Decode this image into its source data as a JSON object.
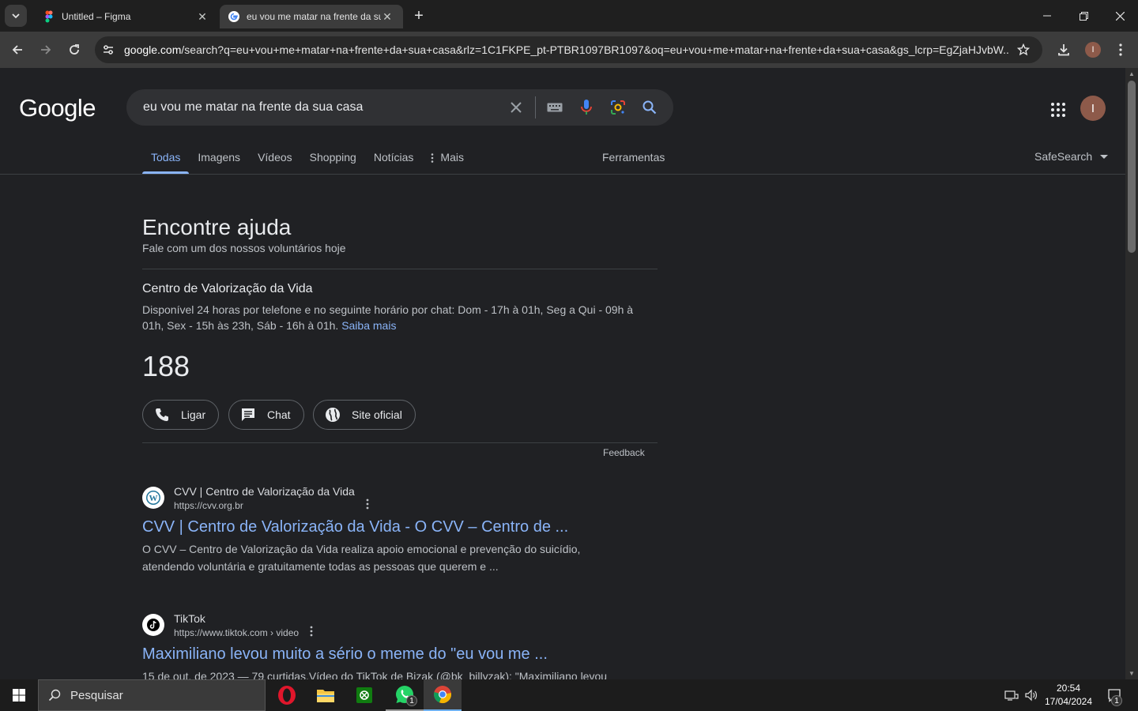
{
  "browser": {
    "tabs": [
      {
        "title": "Untitled – Figma"
      },
      {
        "title": "eu vou me matar na frente da sua casa"
      }
    ],
    "url_host": "google.com",
    "url_rest": "/search?q=eu+vou+me+matar+na+frente+da+sua+casa&rlz=1C1FKPE_pt-PTBR1097BR1097&oq=eu+vou+me+matar+na+frente+da+sua+casa&gs_lcrp=EgZjaHJvbW...",
    "profile_initial": "I"
  },
  "google": {
    "logo": "Google",
    "query": "eu vou me matar na frente da sua casa",
    "avatar_initial": "I",
    "nav_tabs": [
      "Todas",
      "Imagens",
      "Vídeos",
      "Shopping",
      "Notícias",
      "Mais"
    ],
    "tools": "Ferramentas",
    "safesearch": "SafeSearch"
  },
  "help_panel": {
    "title": "Encontre ajuda",
    "subtitle": "Fale com um dos nossos voluntários hoje",
    "org_name": "Centro de Valorização da Vida",
    "description": "Disponível 24 horas por telefone e no seguinte horário por chat: Dom - 17h à 01h, Seg a Qui - 09h à 01h, Sex - 15h às 23h, Sáb - 16h à 01h.",
    "learn_more": "Saiba mais",
    "phone": "188",
    "call_label": "Ligar",
    "chat_label": "Chat",
    "site_label": "Site oficial",
    "feedback": "Feedback"
  },
  "results": [
    {
      "site": "CVV | Centro de Valorização da Vida",
      "url": "https://cvv.org.br",
      "title": "CVV | Centro de Valorização da Vida - O CVV – Centro de ...",
      "snippet": "O CVV – Centro de Valorização da Vida realiza apoio emocional e prevenção do suicídio, atendendo voluntária e gratuitamente todas as pessoas que querem e ..."
    },
    {
      "site": "TikTok",
      "url": "https://www.tiktok.com › video",
      "title": "Maximiliano levou muito a sério o meme do \"eu vou me ...",
      "snippet": "15 de out. de 2023 — 79 curtidas.Vídeo do TikTok de Bizak (@bk_billyzak): \"Maximiliano levou"
    }
  ],
  "taskbar": {
    "search_placeholder": "Pesquisar",
    "whatsapp_badge": "1",
    "notif_badge": "1",
    "time": "20:54",
    "date": "17/04/2024"
  }
}
